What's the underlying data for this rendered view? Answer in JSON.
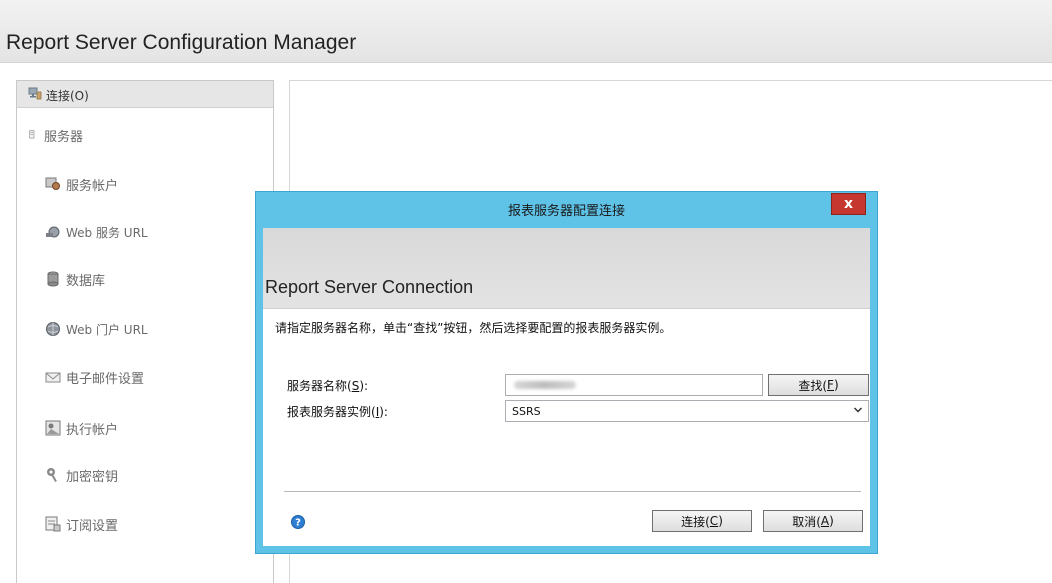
{
  "app": {
    "title": "Report Server Configuration Manager"
  },
  "sidebar": {
    "connect_label": "连接(O)",
    "root_label": "服务器",
    "items": [
      {
        "label": "服务帐户",
        "icon": "service-account-icon"
      },
      {
        "label": "Web 服务 URL",
        "icon": "web-service-url-icon"
      },
      {
        "label": "数据库",
        "icon": "database-icon"
      },
      {
        "label": "Web 门户 URL",
        "icon": "web-portal-icon"
      },
      {
        "label": "电子邮件设置",
        "icon": "email-icon"
      },
      {
        "label": "执行帐户",
        "icon": "execution-account-icon"
      },
      {
        "label": "加密密钥",
        "icon": "key-icon"
      },
      {
        "label": "订阅设置",
        "icon": "subscription-icon"
      }
    ]
  },
  "dialog": {
    "title": "报表服务器配置连接",
    "close_glyph": "x",
    "header_title": "Report Server Connection",
    "instructions": "请指定服务器名称，单击“查找”按钮，然后选择要配置的报表服务器实例。",
    "server_name_label": "服务器名称(S):",
    "server_name_label_pre": "服务器名称(",
    "server_name_label_key": "S",
    "server_name_label_post": "):",
    "find_button_pre": "查找(",
    "find_button_key": "F",
    "find_button_post": ")",
    "instance_label_pre": "报表服务器实例(",
    "instance_label_key": "I",
    "instance_label_post": "):",
    "instance_value": "SSRS",
    "connect_button_pre": "连接(",
    "connect_button_key": "C",
    "connect_button_post": ")",
    "cancel_button_pre": "取消(",
    "cancel_button_key": "A",
    "cancel_button_post": ")"
  },
  "colors": {
    "dialog_frame": "#5fc3e8",
    "close_button": "#c6382f"
  }
}
